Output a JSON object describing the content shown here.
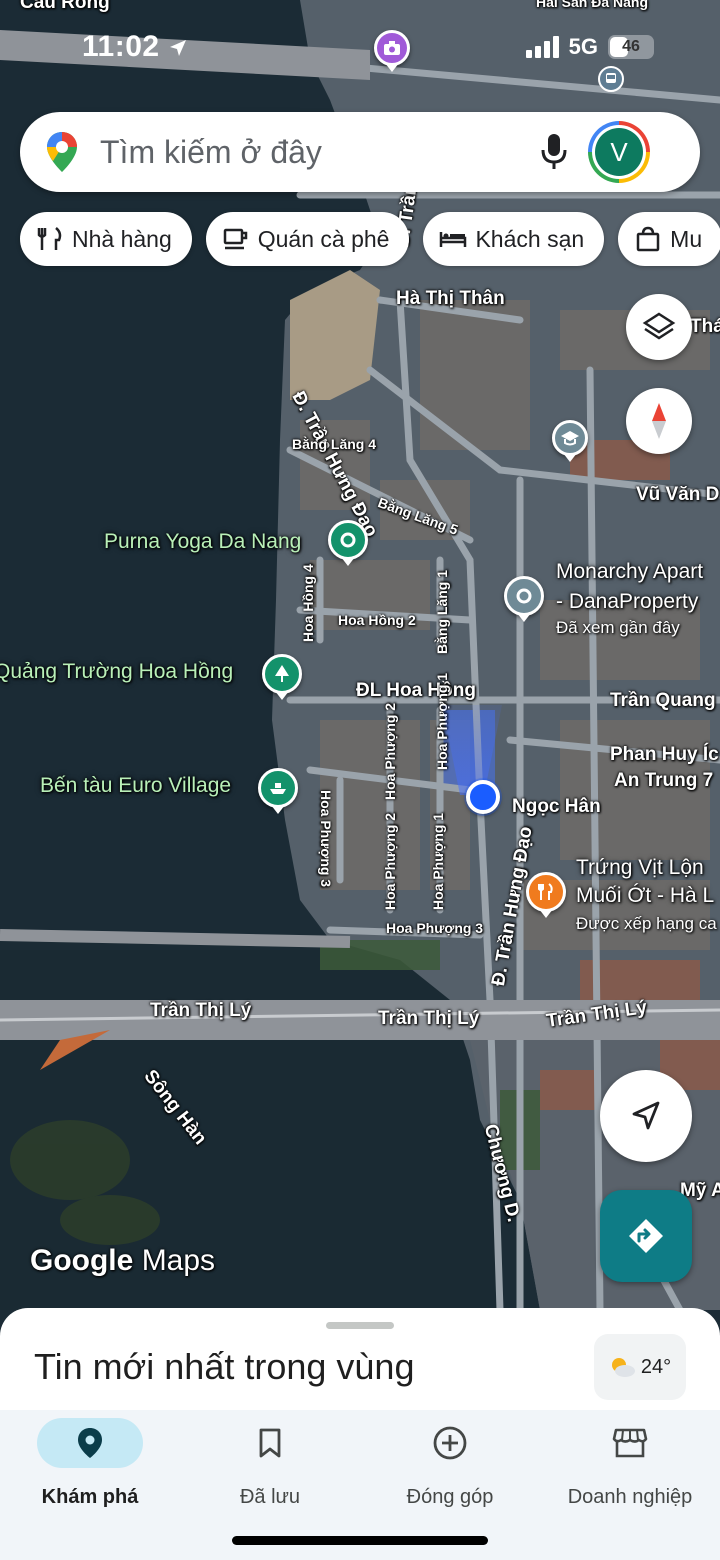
{
  "status_bar": {
    "time": "11:02",
    "network": "5G",
    "battery": "46",
    "top_place": "Cầu Rồng"
  },
  "search": {
    "placeholder": "Tìm kiếm ở đây",
    "avatar_letter": "V"
  },
  "chips": [
    {
      "label": "Nhà hàng",
      "icon": "restaurant-icon"
    },
    {
      "label": "Quán cà phê",
      "icon": "coffee-icon"
    },
    {
      "label": "Khách sạn",
      "icon": "hotel-icon"
    },
    {
      "label": "Mu",
      "icon": "shopping-bag-icon"
    }
  ],
  "map": {
    "streets": {
      "ha_thi_than": "Hà Thị Thân",
      "tran_hung_dao_top": "Đ. Trần Hưng Đạo",
      "tran_hung_dao_vertical": "Đ. Trần",
      "bang_lang_4": "Bằng Lăng 4",
      "bang_lang_5": "Bằng Lăng 5",
      "bang_lang_1": "Bằng Lăng 1",
      "hoa_hong_2": "Hoa Hồng 2",
      "hoa_hong_4": "Hoa Hồng 4",
      "dl_hoa_hong": "ĐL Hoa Hồng",
      "vu_van_d": "Vũ Văn D",
      "tran_quang": "Trần Quang",
      "phan_huy_ich": "Phan Huy Íc",
      "an_trung_7": "An Trung 7",
      "ngoc_han": "Ngọc Hân",
      "hoa_phuong_1": "Hoa Phượng 1",
      "hoa_phuong_2a": "Hoa Phượng 2",
      "hoa_phuong_2b": "Hoa Phượng 2",
      "hoa_phuong_3a": "Hoa Phượng 3",
      "hoa_phuong_3b": "Hoa Phượng 3",
      "tran_hung_dao_lower": "Đ. Trần Hưng Đạo",
      "tran_thi_ly_1": "Trần Thị Lý",
      "tran_thi_ly_2": "Trần Thị Lý",
      "tran_thi_ly_3": "Trần Thị Lý",
      "song_han": "Sông Hàn",
      "chuong_d": "Chương D.",
      "my_1": "Mỹ",
      "my_2": "Mỹ A",
      "thai": "Thá",
      "tran_top_right": "Đ. T",
      "top_right": "Hải Sản Đà Nẵng"
    },
    "pois": {
      "purna": "Purna Yoga Da Nang",
      "monarchy": "Monarchy Apart",
      "monarchy_2": "- DanaProperty",
      "monarchy_sub": "Đã xem gần đây",
      "quang_truong": "Quảng Trường Hoa Hồng",
      "ben_tau": "Bến tàu Euro Village",
      "trung_vit": "Trứng Vịt Lộn",
      "trung_vit_2": "Muối Ớt - Hà L",
      "trung_vit_sub": "Được xếp hạng ca"
    },
    "logo_google": "Google",
    "logo_maps": "Maps"
  },
  "sheet": {
    "title": "Tin mới nhất trong vùng",
    "temperature": "24°"
  },
  "nav": [
    {
      "label": "Khám phá",
      "icon": "explore-pin-icon",
      "active": true
    },
    {
      "label": "Đã lưu",
      "icon": "bookmark-icon",
      "active": false
    },
    {
      "label": "Đóng góp",
      "icon": "add-circle-icon",
      "active": false
    },
    {
      "label": "Doanh nghiệp",
      "icon": "storefront-icon",
      "active": false
    }
  ]
}
